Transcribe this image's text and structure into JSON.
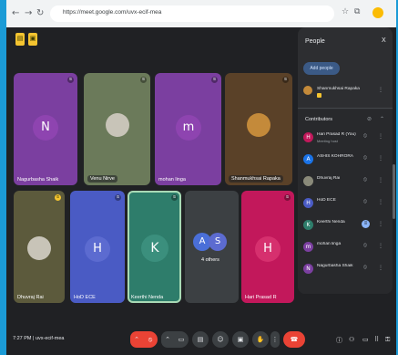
{
  "browser": {
    "url": "https://meet.google.com/uvx-ecif-mea"
  },
  "colors": {
    "accent_blue": "#1b9bd6",
    "end_call_red": "#ea4335",
    "avatar_purple": "#7b3fa0",
    "avatar_blue": "#4a5bc4",
    "avatar_teal": "#2e7d6b",
    "avatar_pink": "#c2185b"
  },
  "tiles": [
    {
      "name": "Nagurbasha Shaik",
      "initial": "N"
    },
    {
      "name": "Venu Nirve",
      "initial": ""
    },
    {
      "name": "mohan linga",
      "initial": "m"
    },
    {
      "name": "Shanmukhsai Rapaka",
      "initial": ""
    },
    {
      "name": "Dhuvraj Rai",
      "initial": ""
    },
    {
      "name": "HoD ECE",
      "initial": "H"
    },
    {
      "name": "Keerthi Nenda",
      "initial": "K"
    },
    {
      "name": "4 others",
      "initial_a": "A",
      "initial_b": "S"
    },
    {
      "name": "Hari Prasad R",
      "initial": "H"
    }
  ],
  "panel": {
    "title": "People",
    "close": "X",
    "add_button": "Add people",
    "host": {
      "name": "Shanmukhsai Rapaka"
    },
    "section_title": "Contributors",
    "participants": [
      {
        "initial": "H",
        "name": "Hari Prasad R (You)",
        "sub": "Meeting host"
      },
      {
        "initial": "A",
        "name": "ASHIS KOHRORA",
        "sub": ""
      },
      {
        "initial": "",
        "name": "Dhuvraj Rai",
        "sub": ""
      },
      {
        "initial": "H",
        "name": "HoD ECE",
        "sub": ""
      },
      {
        "initial": "K",
        "name": "Keerthi Nenda",
        "sub": ""
      },
      {
        "initial": "m",
        "name": "mohan linga",
        "sub": ""
      },
      {
        "initial": "N",
        "name": "Nagurbasha Shaik",
        "sub": ""
      }
    ]
  },
  "bottom": {
    "time_code": "7:27 PM | uvx-ecif-mea"
  },
  "icons": {
    "back": "back-arrow-icon",
    "forward": "forward-arrow-icon",
    "reload": "reload-icon",
    "mic_off": "mic-off-icon",
    "camera": "camera-icon",
    "captions": "captions-icon",
    "emoji": "emoji-icon",
    "present": "present-icon",
    "raise_hand": "raise-hand-icon",
    "more": "more-vert-icon",
    "end_call": "end-call-icon",
    "info": "info-icon",
    "people": "people-icon",
    "chat": "chat-icon",
    "activities": "activities-icon",
    "lock": "lock-icon"
  }
}
